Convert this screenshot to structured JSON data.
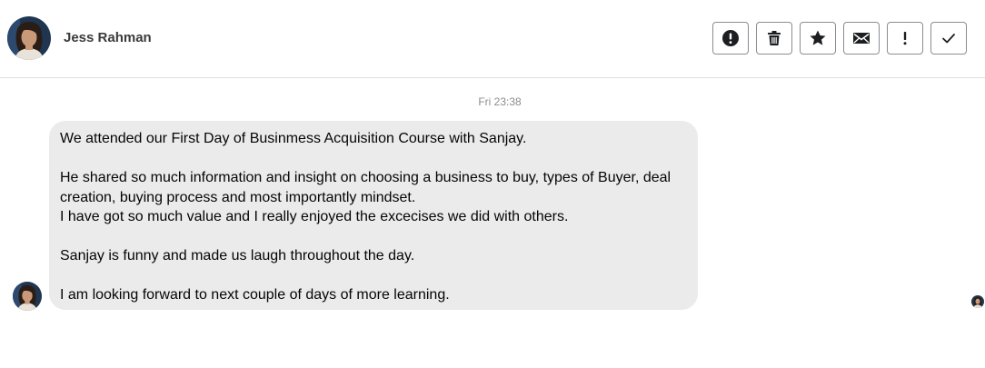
{
  "header": {
    "contact_name": "Jess Rahman",
    "actions": [
      {
        "icon": "report-icon",
        "label": "Report"
      },
      {
        "icon": "trash-icon",
        "label": "Delete"
      },
      {
        "icon": "star-icon",
        "label": "Star"
      },
      {
        "icon": "envelope-icon",
        "label": "Mark as unread"
      },
      {
        "icon": "exclamation-icon",
        "label": "Mark as spam"
      },
      {
        "icon": "checkmark-icon",
        "label": "Mark as done"
      }
    ]
  },
  "conversation": {
    "timestamp": "Fri 23:38",
    "message": {
      "lines": [
        "We attended our First Day of Businmess Acquisition Course with Sanjay.",
        "",
        "He shared so much information and insight on choosing a business to buy, types of Buyer, deal creation, buying process and most importantly mindset.",
        "I have got so much value and I really enjoyed the excecises we did with others.",
        "",
        "Sanjay is funny and made us laugh throughout the day.",
        "",
        "I am looking forward to next couple of days of more learning."
      ]
    }
  },
  "colors": {
    "bubble_bg": "#ebebeb",
    "border": "#8a8d91",
    "divider": "#dddfe2",
    "timestamp": "#8a8d91"
  }
}
